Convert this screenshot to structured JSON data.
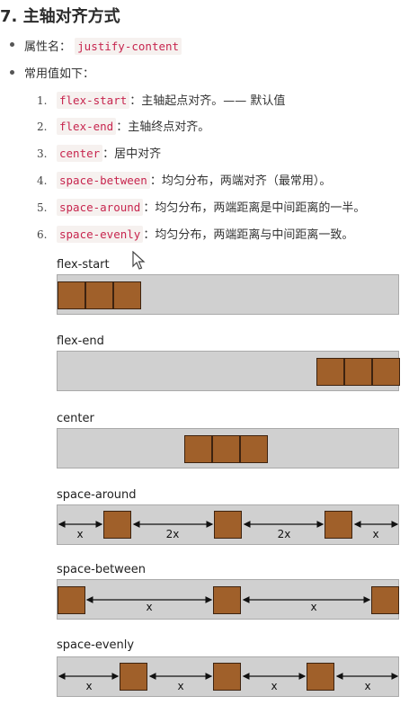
{
  "title": "7. 主轴对齐方式",
  "property": {
    "label": "属性名：",
    "code": "justify-content"
  },
  "values_intro": "常用值如下：",
  "values": [
    {
      "num": "1.",
      "code": "flex-start",
      "desc": "：主轴起点对齐。—— 默认值"
    },
    {
      "num": "2.",
      "code": "flex-end",
      "desc": "：主轴终点对齐。"
    },
    {
      "num": "3.",
      "code": "center",
      "desc": "：居中对齐"
    },
    {
      "num": "4.",
      "code": "space-between",
      "desc": "：均匀分布，两端对齐（最常用）。"
    },
    {
      "num": "5.",
      "code": "space-around",
      "desc": "：均匀分布，两端距离是中间距离的一半。"
    },
    {
      "num": "6.",
      "code": "space-evenly",
      "desc": "：均匀分布，两端距离与中间距离一致。"
    }
  ],
  "diagrams": [
    {
      "label": "flex-start"
    },
    {
      "label": "flex-end"
    },
    {
      "label": "center"
    },
    {
      "label": "space-around",
      "gaps": [
        "x",
        "2x",
        "2x",
        "x"
      ]
    },
    {
      "label": "space-between",
      "gaps": [
        "x",
        "x"
      ]
    },
    {
      "label": "space-evenly",
      "gaps": [
        "x",
        "x",
        "x",
        "x"
      ]
    }
  ],
  "colors": {
    "box": "#a0602a",
    "track": "#d0d0d0",
    "code": "#c7254e"
  }
}
